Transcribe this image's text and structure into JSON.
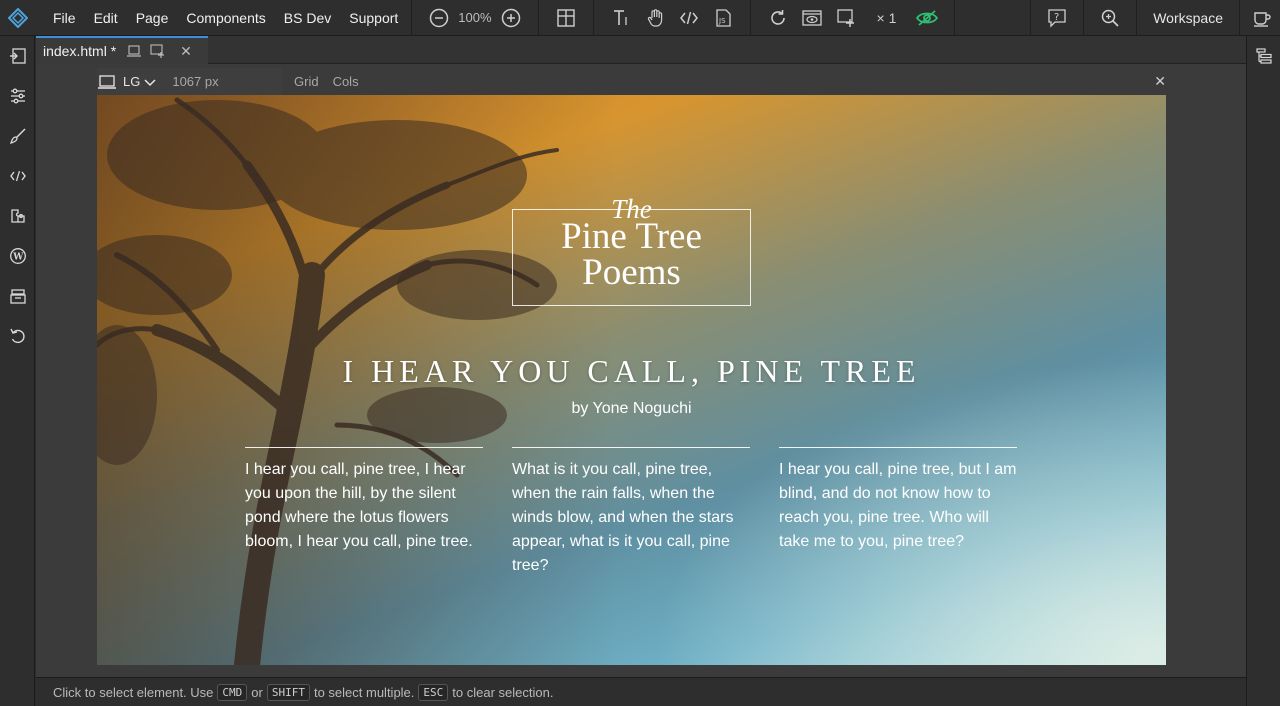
{
  "menu": [
    "File",
    "Edit",
    "Page",
    "Components",
    "BS Dev",
    "Support"
  ],
  "toolbar": {
    "zoom": "100%",
    "multiplier": "× 1",
    "workspace_label": "Workspace",
    "icons": [
      "zoom-out-icon",
      "zoom-in-icon",
      "layout-icon",
      "text-tool-icon",
      "hand-pointer-icon",
      "code-icon",
      "js-icon",
      "refresh-icon",
      "preview-icon",
      "add-frame-icon",
      "visibility-icon",
      "help-icon",
      "magnifier-icon",
      "coffee-icon"
    ]
  },
  "tab": {
    "label": "index.html *"
  },
  "device": {
    "label": "LG",
    "width_label": "1067 px",
    "grid": "Grid",
    "cols": "Cols"
  },
  "page": {
    "title_the": "The",
    "title_main": "Pine Tree Poems",
    "title_line1": "Pine Tree",
    "title_line2": "Poems",
    "poem_title": "I HEAR YOU CALL, PINE TREE",
    "author": "by Yone Noguchi",
    "columns": [
      "I hear you call, pine tree, I hear you upon the hill, by the silent pond where the lotus flowers bloom, I hear you call, pine tree.",
      "What is it you call, pine tree, when the rain falls, when the winds blow, and when the stars appear, what is it you call, pine tree?",
      "I hear you call, pine tree, but I am blind, and do not know how to reach you, pine tree. Who will take me to you, pine tree?"
    ]
  },
  "status": {
    "prefix": "Click to select element. Use",
    "cmd": "CMD",
    "or": "or",
    "shift": "SHIFT",
    "middle": "to select multiple.",
    "esc": "ESC",
    "suffix": "to clear selection."
  },
  "colors": {
    "accent": "#3c8fd8",
    "visibility_green": "#2fbf71"
  }
}
